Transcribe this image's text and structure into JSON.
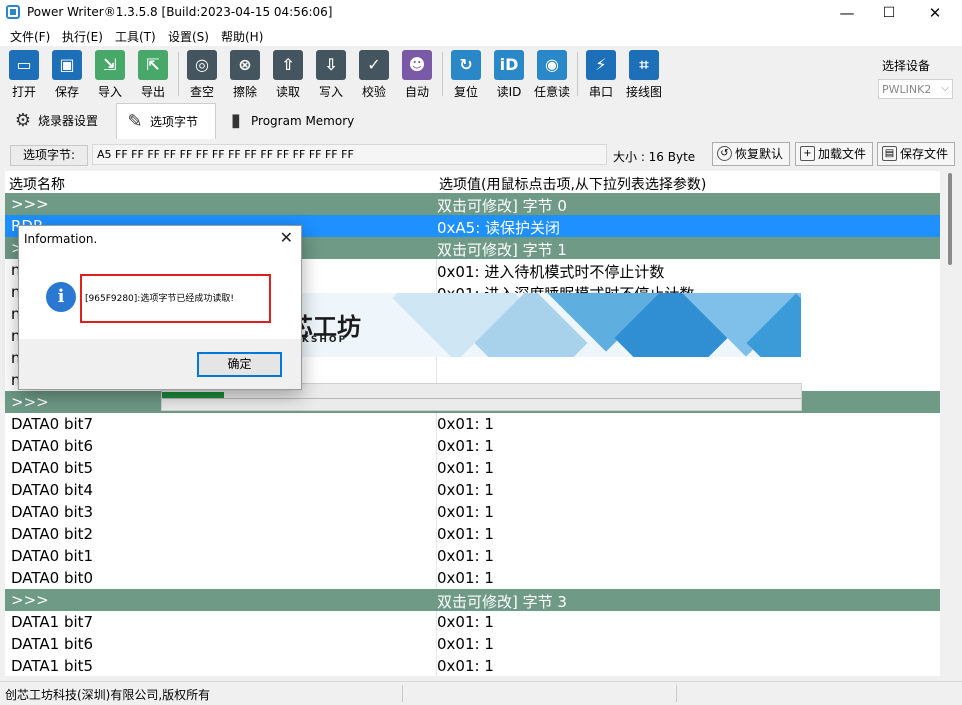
{
  "window": {
    "title": "Power Writer®1.3.5.8 [Build:2023-04-15 04:56:06]",
    "minimize": "—",
    "maximize": "☐",
    "close": "✕"
  },
  "menu": [
    "文件(F)",
    "执行(E)",
    "工具(T)",
    "设置(S)",
    "帮助(H)"
  ],
  "toolbar": {
    "items": [
      {
        "label": "打开",
        "icon": "open-icon",
        "color": "#1d6fb8",
        "glyph": "▭"
      },
      {
        "label": "保存",
        "icon": "save-icon",
        "color": "#1d6fb8",
        "glyph": "▣"
      },
      {
        "label": "导入",
        "icon": "import-icon",
        "color": "#48a86a",
        "glyph": "⇲"
      },
      {
        "label": "导出",
        "icon": "export-icon",
        "color": "#48a86a",
        "glyph": "⇱"
      },
      {
        "label": "查空",
        "icon": "blank-check-icon",
        "color": "#44555f",
        "glyph": "◎"
      },
      {
        "label": "擦除",
        "icon": "erase-icon",
        "color": "#44555f",
        "glyph": "⊗"
      },
      {
        "label": "读取",
        "icon": "read-icon",
        "color": "#44555f",
        "glyph": "⇧"
      },
      {
        "label": "写入",
        "icon": "write-icon",
        "color": "#44555f",
        "glyph": "⇩"
      },
      {
        "label": "校验",
        "icon": "verify-icon",
        "color": "#44555f",
        "glyph": "✓"
      },
      {
        "label": "自动",
        "icon": "auto-robot-icon",
        "color": "#7a5aa6",
        "glyph": "☻"
      },
      {
        "label": "复位",
        "icon": "reset-icon",
        "color": "#2b88c8",
        "glyph": "↻"
      },
      {
        "label": "读ID",
        "icon": "read-id-icon",
        "color": "#2b88c8",
        "glyph": "iD"
      },
      {
        "label": "任意读",
        "icon": "any-read-icon",
        "color": "#2b88c8",
        "glyph": "◉"
      },
      {
        "label": "串口",
        "icon": "serial-port-icon",
        "color": "#1d6fb8",
        "glyph": "⚡"
      },
      {
        "label": "接线图",
        "icon": "wiring-diagram-icon",
        "color": "#1d6fb8",
        "glyph": "⌗"
      }
    ],
    "device_label": "选择设备",
    "device_value": "PWLINK2"
  },
  "tabs": [
    {
      "label": "烧录器设置",
      "icon": "gear-icon",
      "glyph": "⚙"
    },
    {
      "label": "选项字节",
      "icon": "option-edit-icon",
      "glyph": "✎"
    },
    {
      "label": "Program Memory",
      "icon": "memory-chip-icon",
      "glyph": "▮"
    }
  ],
  "option_bar": {
    "label": "选项字节:",
    "hex": "A5 FF FF FF FF FF FF FF FF FF FF FF FF FF FF FF",
    "size": "大小 : 16 Byte",
    "restore": "恢复默认",
    "load": "加载文件",
    "save": "保存文件"
  },
  "table": {
    "headers": [
      "选项名称",
      "选项值(用鼠标点击项,从下拉列表选择参数)"
    ],
    "rows": [
      {
        "type": "group",
        "name": ">>>",
        "value": "双击可修改] 字节 0"
      },
      {
        "type": "selected",
        "name": "RDP",
        "value": "0xA5: 读保护关闭"
      },
      {
        "type": "group",
        "name": ">>>",
        "value": "双击可修改] 字节 1"
      },
      {
        "type": "normal",
        "name": "n",
        "value": "0x01: 进入待机模式时不停止计数"
      },
      {
        "type": "normal",
        "name": "n",
        "value": "0x01: 进入深度睡眠模式时不停止计数"
      },
      {
        "type": "normal",
        "name": "n",
        "value": ""
      },
      {
        "type": "normal",
        "name": "n",
        "value": ""
      },
      {
        "type": "normal",
        "name": "n",
        "value": ""
      },
      {
        "type": "normal",
        "name": "n",
        "value": ""
      },
      {
        "type": "group",
        "name": ">>>",
        "value": ""
      },
      {
        "type": "normal",
        "name": "DATA0 bit7",
        "value": "0x01: 1"
      },
      {
        "type": "normal",
        "name": "DATA0 bit6",
        "value": "0x01: 1"
      },
      {
        "type": "normal",
        "name": "DATA0 bit5",
        "value": "0x01: 1"
      },
      {
        "type": "normal",
        "name": "DATA0 bit4",
        "value": "0x01: 1"
      },
      {
        "type": "normal",
        "name": "DATA0 bit3",
        "value": "0x01: 1"
      },
      {
        "type": "normal",
        "name": "DATA0 bit2",
        "value": "0x01: 1"
      },
      {
        "type": "normal",
        "name": "DATA0 bit1",
        "value": "0x01: 1"
      },
      {
        "type": "normal",
        "name": "DATA0 bit0",
        "value": "0x01: 1"
      },
      {
        "type": "group",
        "name": ">>>",
        "value": "双击可修改] 字节 3"
      },
      {
        "type": "normal",
        "name": "DATA1 bit7",
        "value": "0x01: 1"
      },
      {
        "type": "normal",
        "name": "DATA1 bit6",
        "value": "0x01: 1"
      },
      {
        "type": "normal",
        "name": "DATA1 bit5",
        "value": "0x01: 1"
      }
    ]
  },
  "banner": {
    "brand": "芯工坊",
    "sub": "RKSHOP"
  },
  "progress": {
    "fraction": 0.097
  },
  "dialog": {
    "title": "Information.",
    "close": "✕",
    "message": "[965F9280]:选项字节已经成功读取!",
    "ok": "确定",
    "icon": "info-icon"
  },
  "status": {
    "text": "创芯工坊科技(深圳)有限公司,版权所有"
  },
  "colors": {
    "group_row": "#6e9a86",
    "selected_row": "#1e90ff",
    "dialog_highlight": "#e02020"
  }
}
